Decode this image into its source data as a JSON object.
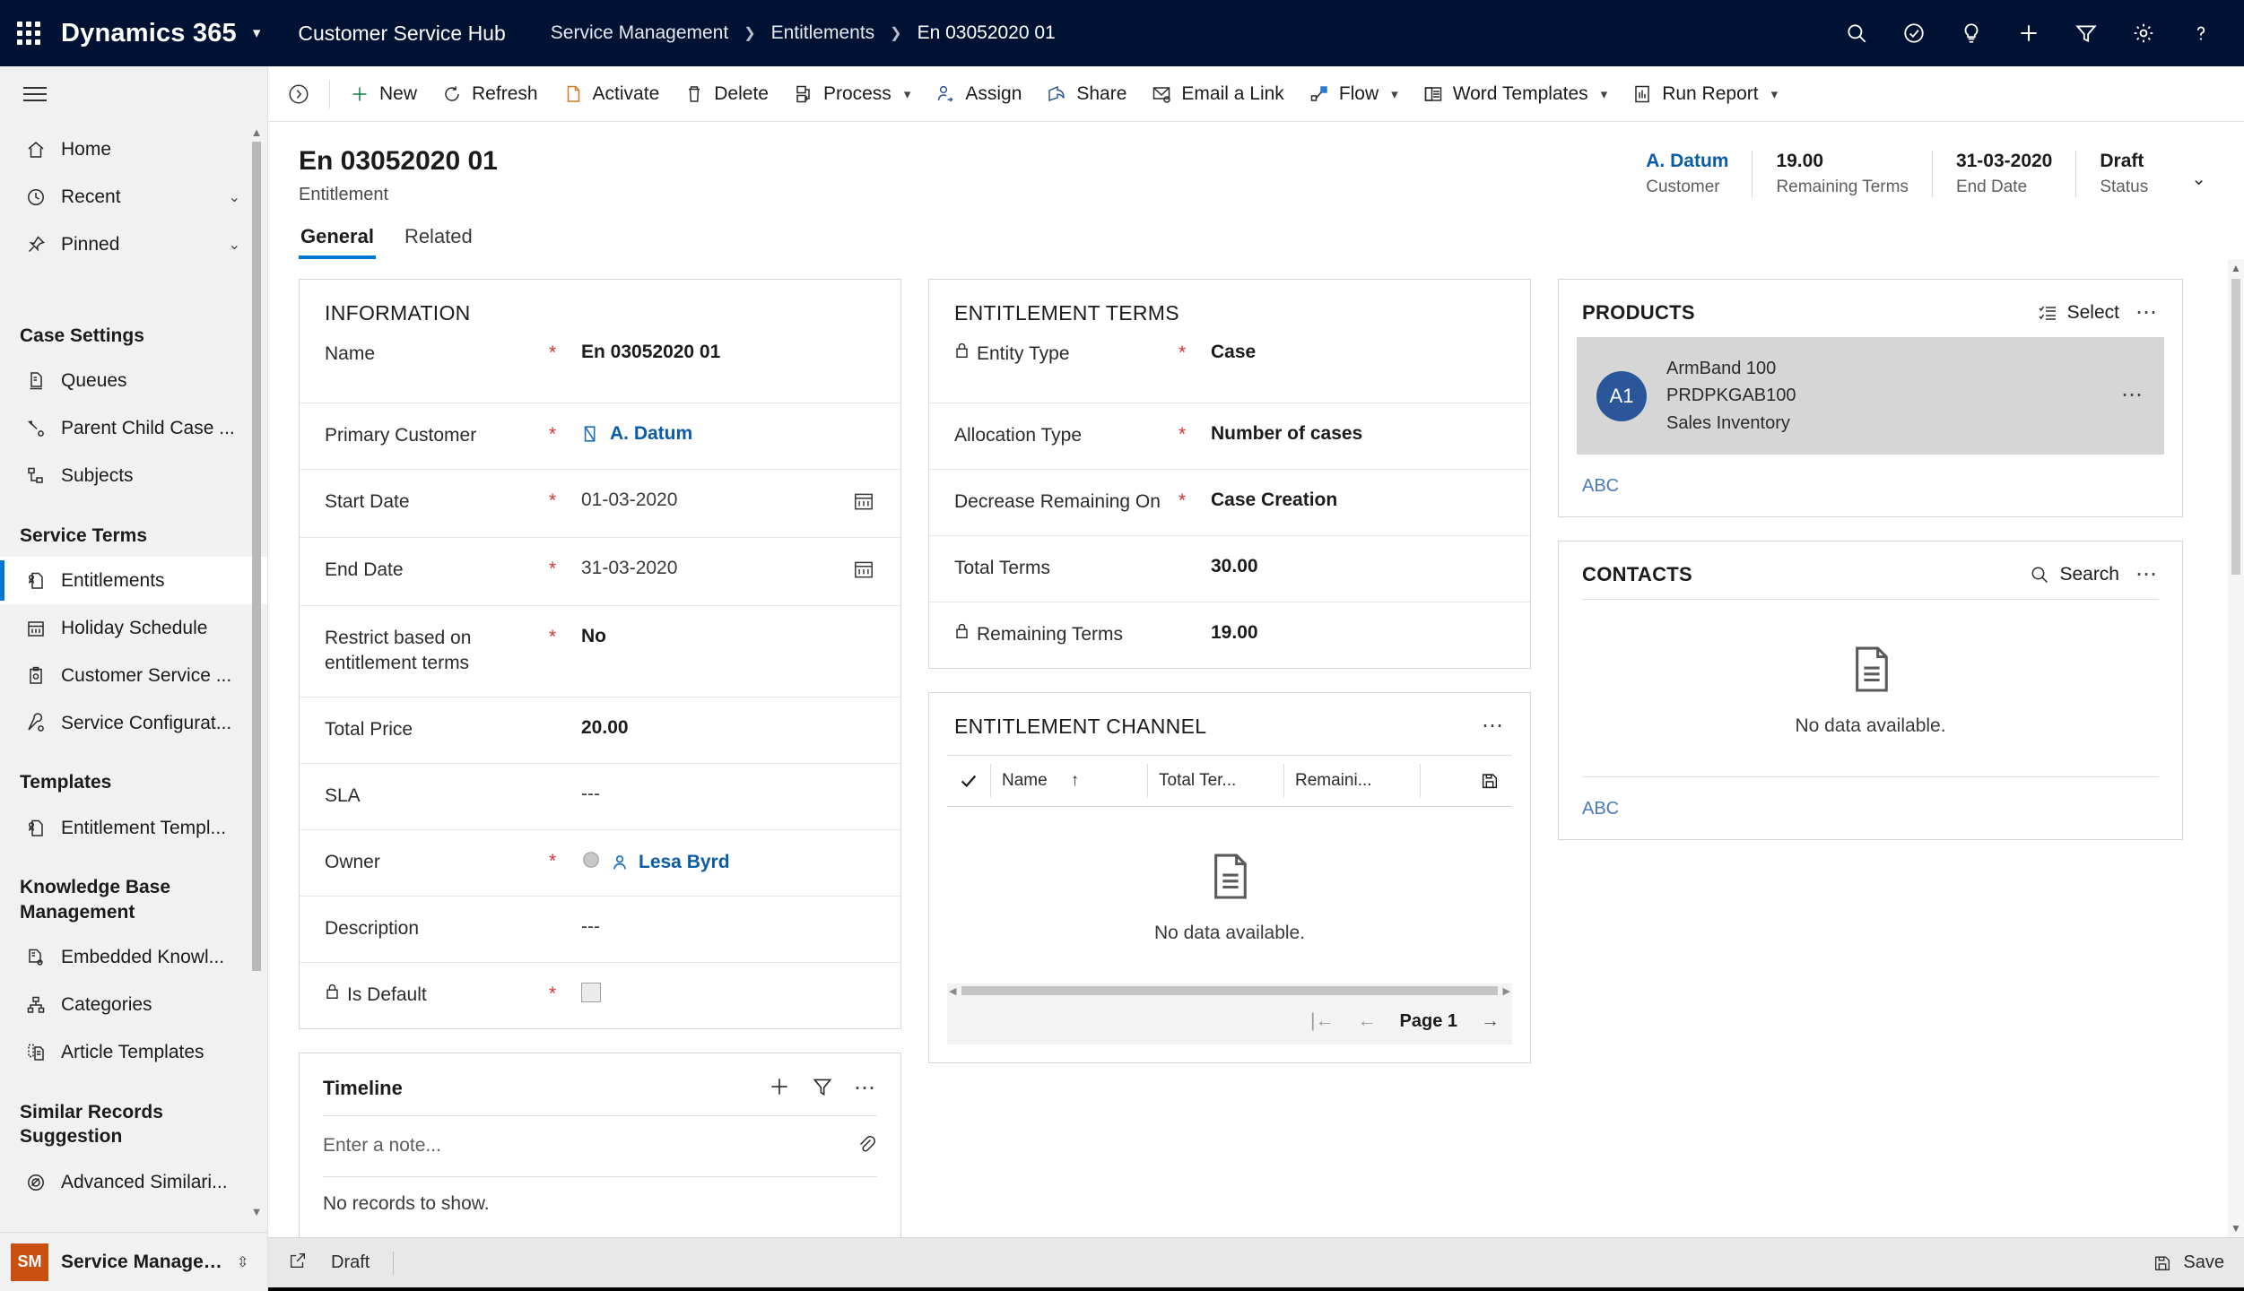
{
  "topbar": {
    "waffle": "app-launcher",
    "brand": "Dynamics 365",
    "app_name": "Customer Service Hub",
    "breadcrumb": [
      "Service Management",
      "Entitlements",
      "En 03052020 01"
    ],
    "actions": [
      "search-icon",
      "check-circle-icon",
      "lightbulb-icon",
      "plus-icon",
      "filter-icon",
      "gear-icon",
      "help-icon"
    ]
  },
  "sidebar": {
    "hamburger": "site-map-hamburger",
    "items": [
      {
        "label": "Home",
        "icon": "home-icon",
        "chevron": "",
        "selected": false
      },
      {
        "label": "Recent",
        "icon": "clock-icon",
        "chevron": "⌄",
        "selected": false
      },
      {
        "label": "Pinned",
        "icon": "pin-icon",
        "chevron": "⌄",
        "selected": false
      }
    ],
    "groups": [
      {
        "title": "Case Settings",
        "items": [
          {
            "label": "Queues",
            "icon": "queue-icon",
            "selected": false
          },
          {
            "label": "Parent Child Case ...",
            "icon": "case-relationship-icon",
            "selected": false
          },
          {
            "label": "Subjects",
            "icon": "hierarchy-icon",
            "selected": false
          }
        ]
      },
      {
        "title": "Service Terms",
        "items": [
          {
            "label": "Entitlements",
            "icon": "entitlement-icon",
            "selected": true
          },
          {
            "label": "Holiday Schedule",
            "icon": "calendar-icon",
            "selected": false
          },
          {
            "label": "Customer Service ...",
            "icon": "clipboard-gear-icon",
            "selected": false
          },
          {
            "label": "Service Configurat...",
            "icon": "wrench-gear-icon",
            "selected": false
          }
        ]
      },
      {
        "title": "Templates",
        "items": [
          {
            "label": "Entitlement Templ...",
            "icon": "entitlement-template-icon",
            "selected": false
          }
        ]
      },
      {
        "title": "Knowledge Base Management",
        "items": [
          {
            "label": "Embedded Knowl...",
            "icon": "document-gear-icon",
            "selected": false
          },
          {
            "label": "Categories",
            "icon": "category-icon",
            "selected": false
          },
          {
            "label": "Article Templates",
            "icon": "article-template-icon",
            "selected": false
          }
        ]
      },
      {
        "title": "Similar Records Suggestion",
        "items": [
          {
            "label": "Advanced Similari...",
            "icon": "similarity-icon",
            "selected": false
          }
        ]
      }
    ],
    "footer": {
      "badge": "SM",
      "label": "Service Managem...",
      "chevron": "⌃⌄"
    }
  },
  "commandbar": {
    "collapse": "collapse-chevron-icon",
    "buttons": [
      {
        "label": "New",
        "icon": "plus-icon",
        "caret": false
      },
      {
        "label": "Refresh",
        "icon": "refresh-icon",
        "caret": false
      },
      {
        "label": "Activate",
        "icon": "activate-icon",
        "caret": false
      },
      {
        "label": "Delete",
        "icon": "trash-icon",
        "caret": false
      },
      {
        "label": "Process",
        "icon": "process-icon",
        "caret": true
      },
      {
        "label": "Assign",
        "icon": "assign-user-icon",
        "caret": false
      },
      {
        "label": "Share",
        "icon": "share-icon",
        "caret": false
      },
      {
        "label": "Email a Link",
        "icon": "email-link-icon",
        "caret": false
      },
      {
        "label": "Flow",
        "icon": "flow-icon",
        "caret": true
      },
      {
        "label": "Word Templates",
        "icon": "word-template-icon",
        "caret": true
      },
      {
        "label": "Run Report",
        "icon": "report-icon",
        "caret": true
      }
    ]
  },
  "record": {
    "title": "En 03052020 01",
    "subtitle": "Entitlement",
    "stats": [
      {
        "value": "A. Datum",
        "label": "Customer",
        "link": true
      },
      {
        "value": "19.00",
        "label": "Remaining Terms",
        "link": false
      },
      {
        "value": "31-03-2020",
        "label": "End Date",
        "link": false
      },
      {
        "value": "Draft",
        "label": "Status",
        "link": false
      }
    ],
    "expand_chevron": "⌄"
  },
  "tabs": [
    {
      "label": "General",
      "active": true
    },
    {
      "label": "Related",
      "active": false
    }
  ],
  "information": {
    "title": "INFORMATION",
    "fields": [
      {
        "label": "Name",
        "required": true,
        "value": "En 03052020 01",
        "type": "text",
        "locked": false
      },
      {
        "label": "Primary Customer",
        "required": true,
        "value": "A. Datum",
        "type": "lookup-account",
        "locked": false
      },
      {
        "label": "Start Date",
        "required": true,
        "value": "01-03-2020",
        "type": "date",
        "locked": false
      },
      {
        "label": "End Date",
        "required": true,
        "value": "31-03-2020",
        "type": "date",
        "locked": false
      },
      {
        "label": "Restrict based on entitlement terms",
        "required": true,
        "value": "No",
        "type": "text",
        "locked": false
      },
      {
        "label": "Total Price",
        "required": false,
        "value": "20.00",
        "type": "text",
        "locked": false
      },
      {
        "label": "SLA",
        "required": false,
        "value": "---",
        "type": "plain",
        "locked": false
      },
      {
        "label": "Owner",
        "required": true,
        "value": "Lesa Byrd",
        "type": "lookup-user",
        "locked": false
      },
      {
        "label": "Description",
        "required": false,
        "value": "---",
        "type": "plain",
        "locked": false
      },
      {
        "label": "Is Default",
        "required": true,
        "value": "",
        "type": "checkbox",
        "locked": true
      }
    ]
  },
  "entitlement_terms": {
    "title": "ENTITLEMENT TERMS",
    "fields": [
      {
        "label": "Entity Type",
        "required": true,
        "value": "Case",
        "locked": true
      },
      {
        "label": "Allocation Type",
        "required": true,
        "value": "Number of cases",
        "locked": false
      },
      {
        "label": "Decrease Remaining On",
        "required": true,
        "value": "Case Creation",
        "locked": false
      },
      {
        "label": "Total Terms",
        "required": false,
        "value": "30.00",
        "locked": false
      },
      {
        "label": "Remaining Terms",
        "required": false,
        "value": "19.00",
        "locked": true
      }
    ]
  },
  "entitlement_channel": {
    "title": "ENTITLEMENT CHANNEL",
    "more": "more-commands-icon",
    "columns": [
      "Name",
      "Total Ter...",
      "Remaini..."
    ],
    "sort_indicator": "↑",
    "save_icon": "save-grid-icon",
    "empty_text": "No data available.",
    "pager": {
      "first": "|←",
      "prev": "←",
      "page": "Page 1",
      "next": "→"
    }
  },
  "products": {
    "title": "PRODUCTS",
    "select_label": "Select",
    "select_icon": "select-list-icon",
    "more": "more-commands-icon",
    "rows": [
      {
        "initials": "A1",
        "name": "ArmBand 100",
        "code": "PRDPKGAB100",
        "group": "Sales Inventory",
        "row_more": "row-more-icon"
      }
    ],
    "footer_link": "ABC"
  },
  "contacts": {
    "title": "CONTACTS",
    "search_label": "Search",
    "search_icon": "search-icon",
    "more": "more-commands-icon",
    "empty_text": "No data available.",
    "footer_link": "ABC"
  },
  "timeline": {
    "title": "Timeline",
    "add_icon": "plus-icon",
    "filter_icon": "filter-icon",
    "more": "more-commands-icon",
    "note_placeholder": "Enter a note...",
    "attach_icon": "paperclip-icon",
    "empty_text": "No records to show."
  },
  "statusbar": {
    "popout_icon": "popout-icon",
    "status": "Draft",
    "save_label": "Save",
    "save_icon": "save-icon"
  },
  "colors": {
    "nav_bg": "#001234",
    "accent": "#0078d4",
    "required": "#d13438",
    "link": "#0b5ca8",
    "avatar": "#2b579a",
    "badge": "#ca5010"
  }
}
